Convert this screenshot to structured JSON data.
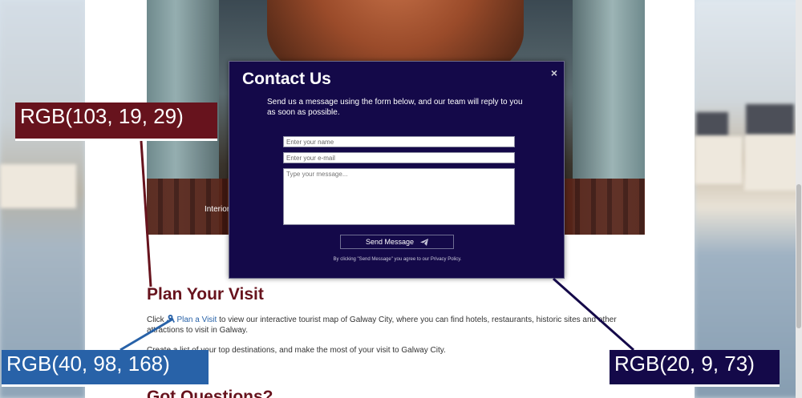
{
  "hero": {
    "caption": "Interior of St Nicholas Cathedral, Europe"
  },
  "plan": {
    "title": "Plan Your Visit",
    "para1_before": "Click",
    "link_label": "Plan a Visit",
    "para1_after": "to view our interactive tourist map of Galway City, where you can find hotels, restaurants, historic sites and other attractions to visit in Galway.",
    "para2": "Create a list of your top destinations, and make the most of your visit to Galway City."
  },
  "questions": {
    "title": "Got Questions?"
  },
  "modal": {
    "title": "Contact Us",
    "close": "×",
    "description": "Send us a message using the form below, and our team will reply to you as soon as possible.",
    "name_placeholder": "Enter your name",
    "email_placeholder": "Enter your e-mail",
    "message_placeholder": "Type your message...",
    "send_label": "Send Message",
    "privacy": "By clicking \"Send Message\" you agree to our Privacy Policy."
  },
  "annotations": {
    "a1": "RGB(103, 19, 29)",
    "a2": "RGB(40, 98, 168)",
    "a3": "RGB(20, 9, 73)"
  },
  "colors": {
    "heading": "#67131d",
    "link": "#2862a8",
    "modal_bg": "#140949"
  },
  "icons": {
    "close": "close-icon",
    "map": "map-marker-icon",
    "send": "paper-plane-icon"
  }
}
